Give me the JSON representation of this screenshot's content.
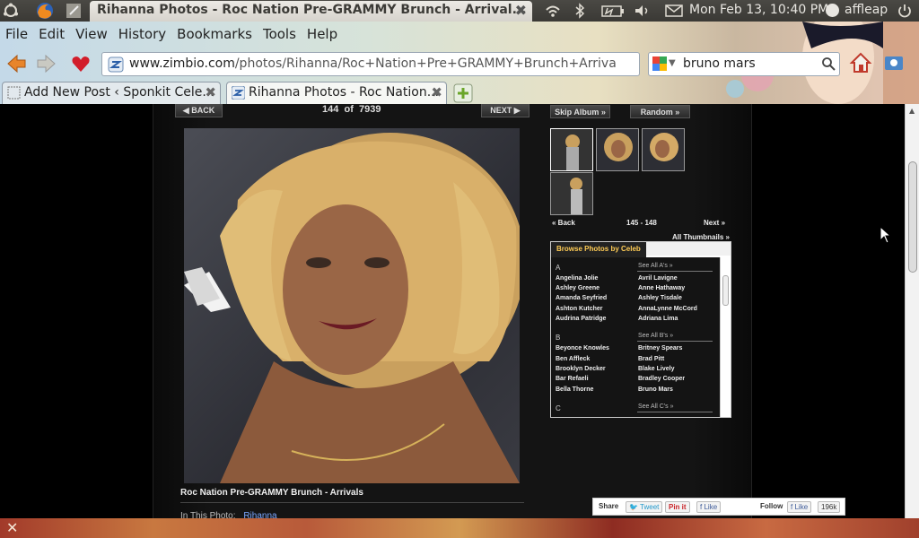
{
  "panel": {
    "window_title": "Rihanna Photos - Roc Nation Pre-GRAMMY Brunch - Arrival...",
    "clock": "Mon Feb 13, 10:40 PM",
    "user": "affleap"
  },
  "menu": [
    "File",
    "Edit",
    "View",
    "History",
    "Bookmarks",
    "Tools",
    "Help"
  ],
  "navigation": {
    "url_host": "www.zimbio.com",
    "url_path": "/photos/Rihanna/Roc+Nation+Pre+GRAMMY+Brunch+Arriva",
    "search_value": "bruno mars"
  },
  "tabs": [
    {
      "label": "Add New Post ‹ Sponkit Cele...",
      "active": false
    },
    {
      "label": "Rihanna Photos - Roc Nation...",
      "active": true
    }
  ],
  "gallery": {
    "back_label": "◀ BACK",
    "next_label": "NEXT ▶",
    "current": "144",
    "of_label": "of",
    "total": "7939",
    "skip_album": "Skip Album »",
    "random": "Random »",
    "caption": "Roc Nation Pre-GRAMMY Brunch - Arrivals",
    "in_this_photo_label": "In This Photo:",
    "in_this_photo_name": "Rihanna",
    "thumb_back": "« Back",
    "thumb_range": "145 - 148",
    "thumb_next": "Next »",
    "all_thumbnails": "All Thumbnails »"
  },
  "browse": {
    "tab_label": "Browse Photos by Celeb",
    "groups": [
      {
        "letter": "A",
        "see_all": "See All A's »",
        "col1": [
          "Angelina Jolie",
          "Ashley Greene",
          "Amanda Seyfried",
          "Ashton Kutcher",
          "Audrina Patridge"
        ],
        "col2": [
          "Avril Lavigne",
          "Anne Hathaway",
          "Ashley Tisdale",
          "AnnaLynne McCord",
          "Adriana Lima"
        ]
      },
      {
        "letter": "B",
        "see_all": "See All B's »",
        "col1": [
          "Beyonce Knowles",
          "Ben Affleck",
          "Brooklyn Decker",
          "Bar Refaeli",
          "Bella Thorne"
        ],
        "col2": [
          "Britney Spears",
          "Brad Pitt",
          "Blake Lively",
          "Bradley Cooper",
          "Bruno Mars"
        ]
      },
      {
        "letter": "C",
        "see_all": "See All C's »",
        "col1": [],
        "col2": []
      }
    ]
  },
  "share": {
    "share_label": "Share",
    "tweet": "Tweet",
    "pinit": "Pin it",
    "like": "Like",
    "follow_label": "Follow",
    "follow_like": "Like",
    "follow_count": "196k"
  },
  "colors": {
    "page_bg": "#000000",
    "column_bg": "#141414",
    "browse_tab_text": "#ffcc55",
    "link_blue": "#7aa7ff"
  }
}
